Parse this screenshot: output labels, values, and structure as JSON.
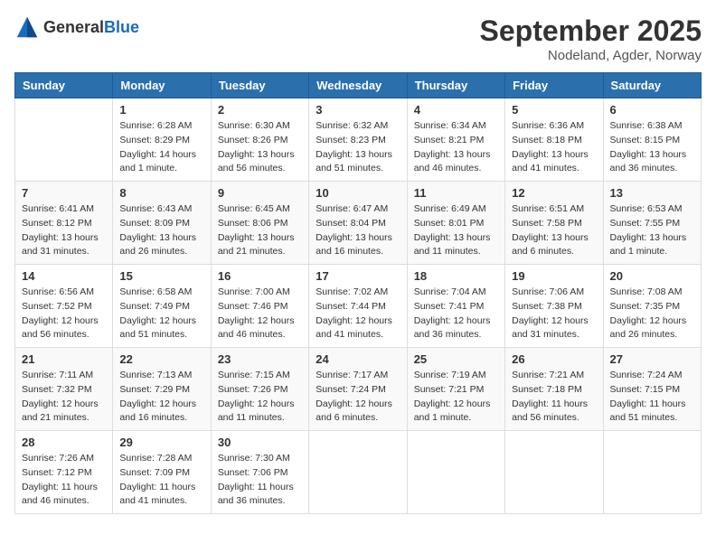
{
  "header": {
    "logo_general": "General",
    "logo_blue": "Blue",
    "month": "September 2025",
    "location": "Nodeland, Agder, Norway"
  },
  "weekdays": [
    "Sunday",
    "Monday",
    "Tuesday",
    "Wednesday",
    "Thursday",
    "Friday",
    "Saturday"
  ],
  "weeks": [
    [
      {
        "day": "",
        "sunrise": "",
        "sunset": "",
        "daylight": ""
      },
      {
        "day": "1",
        "sunrise": "Sunrise: 6:28 AM",
        "sunset": "Sunset: 8:29 PM",
        "daylight": "Daylight: 14 hours and 1 minute."
      },
      {
        "day": "2",
        "sunrise": "Sunrise: 6:30 AM",
        "sunset": "Sunset: 8:26 PM",
        "daylight": "Daylight: 13 hours and 56 minutes."
      },
      {
        "day": "3",
        "sunrise": "Sunrise: 6:32 AM",
        "sunset": "Sunset: 8:23 PM",
        "daylight": "Daylight: 13 hours and 51 minutes."
      },
      {
        "day": "4",
        "sunrise": "Sunrise: 6:34 AM",
        "sunset": "Sunset: 8:21 PM",
        "daylight": "Daylight: 13 hours and 46 minutes."
      },
      {
        "day": "5",
        "sunrise": "Sunrise: 6:36 AM",
        "sunset": "Sunset: 8:18 PM",
        "daylight": "Daylight: 13 hours and 41 minutes."
      },
      {
        "day": "6",
        "sunrise": "Sunrise: 6:38 AM",
        "sunset": "Sunset: 8:15 PM",
        "daylight": "Daylight: 13 hours and 36 minutes."
      }
    ],
    [
      {
        "day": "7",
        "sunrise": "Sunrise: 6:41 AM",
        "sunset": "Sunset: 8:12 PM",
        "daylight": "Daylight: 13 hours and 31 minutes."
      },
      {
        "day": "8",
        "sunrise": "Sunrise: 6:43 AM",
        "sunset": "Sunset: 8:09 PM",
        "daylight": "Daylight: 13 hours and 26 minutes."
      },
      {
        "day": "9",
        "sunrise": "Sunrise: 6:45 AM",
        "sunset": "Sunset: 8:06 PM",
        "daylight": "Daylight: 13 hours and 21 minutes."
      },
      {
        "day": "10",
        "sunrise": "Sunrise: 6:47 AM",
        "sunset": "Sunset: 8:04 PM",
        "daylight": "Daylight: 13 hours and 16 minutes."
      },
      {
        "day": "11",
        "sunrise": "Sunrise: 6:49 AM",
        "sunset": "Sunset: 8:01 PM",
        "daylight": "Daylight: 13 hours and 11 minutes."
      },
      {
        "day": "12",
        "sunrise": "Sunrise: 6:51 AM",
        "sunset": "Sunset: 7:58 PM",
        "daylight": "Daylight: 13 hours and 6 minutes."
      },
      {
        "day": "13",
        "sunrise": "Sunrise: 6:53 AM",
        "sunset": "Sunset: 7:55 PM",
        "daylight": "Daylight: 13 hours and 1 minute."
      }
    ],
    [
      {
        "day": "14",
        "sunrise": "Sunrise: 6:56 AM",
        "sunset": "Sunset: 7:52 PM",
        "daylight": "Daylight: 12 hours and 56 minutes."
      },
      {
        "day": "15",
        "sunrise": "Sunrise: 6:58 AM",
        "sunset": "Sunset: 7:49 PM",
        "daylight": "Daylight: 12 hours and 51 minutes."
      },
      {
        "day": "16",
        "sunrise": "Sunrise: 7:00 AM",
        "sunset": "Sunset: 7:46 PM",
        "daylight": "Daylight: 12 hours and 46 minutes."
      },
      {
        "day": "17",
        "sunrise": "Sunrise: 7:02 AM",
        "sunset": "Sunset: 7:44 PM",
        "daylight": "Daylight: 12 hours and 41 minutes."
      },
      {
        "day": "18",
        "sunrise": "Sunrise: 7:04 AM",
        "sunset": "Sunset: 7:41 PM",
        "daylight": "Daylight: 12 hours and 36 minutes."
      },
      {
        "day": "19",
        "sunrise": "Sunrise: 7:06 AM",
        "sunset": "Sunset: 7:38 PM",
        "daylight": "Daylight: 12 hours and 31 minutes."
      },
      {
        "day": "20",
        "sunrise": "Sunrise: 7:08 AM",
        "sunset": "Sunset: 7:35 PM",
        "daylight": "Daylight: 12 hours and 26 minutes."
      }
    ],
    [
      {
        "day": "21",
        "sunrise": "Sunrise: 7:11 AM",
        "sunset": "Sunset: 7:32 PM",
        "daylight": "Daylight: 12 hours and 21 minutes."
      },
      {
        "day": "22",
        "sunrise": "Sunrise: 7:13 AM",
        "sunset": "Sunset: 7:29 PM",
        "daylight": "Daylight: 12 hours and 16 minutes."
      },
      {
        "day": "23",
        "sunrise": "Sunrise: 7:15 AM",
        "sunset": "Sunset: 7:26 PM",
        "daylight": "Daylight: 12 hours and 11 minutes."
      },
      {
        "day": "24",
        "sunrise": "Sunrise: 7:17 AM",
        "sunset": "Sunset: 7:24 PM",
        "daylight": "Daylight: 12 hours and 6 minutes."
      },
      {
        "day": "25",
        "sunrise": "Sunrise: 7:19 AM",
        "sunset": "Sunset: 7:21 PM",
        "daylight": "Daylight: 12 hours and 1 minute."
      },
      {
        "day": "26",
        "sunrise": "Sunrise: 7:21 AM",
        "sunset": "Sunset: 7:18 PM",
        "daylight": "Daylight: 11 hours and 56 minutes."
      },
      {
        "day": "27",
        "sunrise": "Sunrise: 7:24 AM",
        "sunset": "Sunset: 7:15 PM",
        "daylight": "Daylight: 11 hours and 51 minutes."
      }
    ],
    [
      {
        "day": "28",
        "sunrise": "Sunrise: 7:26 AM",
        "sunset": "Sunset: 7:12 PM",
        "daylight": "Daylight: 11 hours and 46 minutes."
      },
      {
        "day": "29",
        "sunrise": "Sunrise: 7:28 AM",
        "sunset": "Sunset: 7:09 PM",
        "daylight": "Daylight: 11 hours and 41 minutes."
      },
      {
        "day": "30",
        "sunrise": "Sunrise: 7:30 AM",
        "sunset": "Sunset: 7:06 PM",
        "daylight": "Daylight: 11 hours and 36 minutes."
      },
      {
        "day": "",
        "sunrise": "",
        "sunset": "",
        "daylight": ""
      },
      {
        "day": "",
        "sunrise": "",
        "sunset": "",
        "daylight": ""
      },
      {
        "day": "",
        "sunrise": "",
        "sunset": "",
        "daylight": ""
      },
      {
        "day": "",
        "sunrise": "",
        "sunset": "",
        "daylight": ""
      }
    ]
  ]
}
